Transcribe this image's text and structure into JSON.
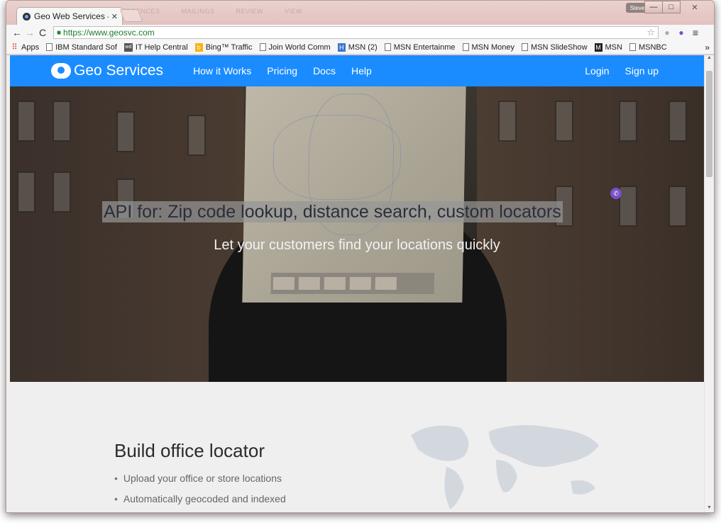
{
  "browser": {
    "tab_title": "Geo Web Services - (",
    "url_host": "https://www.geosvc.com",
    "user_chip": "Steve",
    "ghost_ribbon": [
      "REFERENCES",
      "MAILINGS",
      "REVIEW",
      "VIEW"
    ],
    "window_buttons": [
      "—",
      "□",
      "✕"
    ],
    "bookmarks": [
      {
        "label": "Apps",
        "icon": "apps-icon"
      },
      {
        "label": "IBM Standard Sof",
        "icon": "page-icon"
      },
      {
        "label": "IT Help Central",
        "icon": "wd-icon"
      },
      {
        "label": "Bing™ Traffic",
        "icon": "bing-icon"
      },
      {
        "label": "Join World Comm",
        "icon": "page-icon"
      },
      {
        "label": "MSN (2)",
        "icon": "h-icon"
      },
      {
        "label": "MSN Entertainme",
        "icon": "page-icon"
      },
      {
        "label": "MSN Money",
        "icon": "page-icon"
      },
      {
        "label": "MSN SlideShow",
        "icon": "page-icon"
      },
      {
        "label": "MSN",
        "icon": "msn-icon"
      },
      {
        "label": "MSNBC",
        "icon": "page-icon"
      }
    ],
    "more": "»"
  },
  "site": {
    "logo_text": "Geo Services",
    "nav": [
      "How it Works",
      "Pricing",
      "Docs",
      "Help"
    ],
    "login": "Login",
    "signup": "Sign up",
    "brand_color": "#1a8cff"
  },
  "hero": {
    "headline": "API for: Zip code lookup, distance search, custom locators",
    "subline": "Let your customers find your locations quickly"
  },
  "feature": {
    "title": "Build office locator",
    "bullets": [
      "Upload your office or store locations",
      "Automatically geocoded and indexed"
    ]
  }
}
